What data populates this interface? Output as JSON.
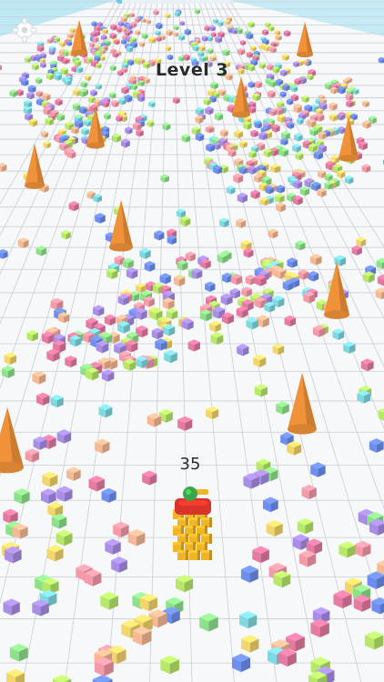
{
  "hud": {
    "level_label": "Level 3",
    "crowd_count": "35",
    "progress_fraction": 0.05
  },
  "icons": {
    "settings": "gear-icon"
  },
  "colors": {
    "sky": "#bfe8f5",
    "floor": "#f6f8fa",
    "grid_line": "#c9ced6",
    "cone": "#f0923a",
    "player_skin": "#f0b429",
    "player_shirt": "#d8342a",
    "player_helmet": "#3aa64a",
    "cube_palette": [
      "#8fe08a",
      "#f59aa8",
      "#a88ee6",
      "#7fd9e0",
      "#f7b894",
      "#f2d66b",
      "#6f8ff0",
      "#e57aa3",
      "#b7e86a"
    ]
  }
}
